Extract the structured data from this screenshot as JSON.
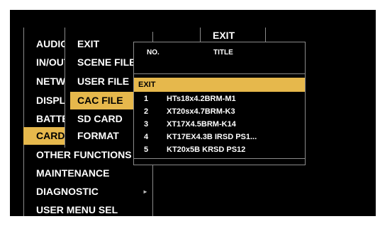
{
  "colors": {
    "highlight": "#e6b84c",
    "background": "#000000",
    "text": "#ffffff",
    "divider": "#8a8a8a"
  },
  "main_menu": {
    "items": [
      {
        "label": "AUDIO"
      },
      {
        "label": "IN/OUT"
      },
      {
        "label": "NETWORK"
      },
      {
        "label": "DISPLAY"
      },
      {
        "label": "BATTERY"
      },
      {
        "label": "CARD"
      },
      {
        "label": "OTHER FUNCTIONS"
      },
      {
        "label": "MAINTENANCE"
      },
      {
        "label": "DIAGNOSTIC"
      },
      {
        "label": "USER MENU SEL"
      }
    ],
    "selected": "CARD"
  },
  "sub_menu": {
    "items": [
      {
        "label": "EXIT"
      },
      {
        "label": "SCENE FILE"
      },
      {
        "label": "USER FILE"
      },
      {
        "label": "CAC FILE"
      },
      {
        "label": "SD CARD"
      },
      {
        "label": "FORMAT"
      }
    ],
    "selected": "CAC FILE"
  },
  "third_column": {
    "label": "EXIT"
  },
  "submenu_arrow_icon": "right-triangle",
  "popup": {
    "header_no": "NO.",
    "header_title": "TITLE",
    "exit_label": "EXIT",
    "rows": [
      {
        "no": "1",
        "title": "HTs18x4.2BRM-M1"
      },
      {
        "no": "2",
        "title": "XT20sx4.7BRM-K3"
      },
      {
        "no": "3",
        "title": "XT17X4.5BRM-K14"
      },
      {
        "no": "4",
        "title": "KT17EX4.3B IRSD PS1..."
      },
      {
        "no": "5",
        "title": "KT20x5B KRSD PS12"
      }
    ]
  }
}
